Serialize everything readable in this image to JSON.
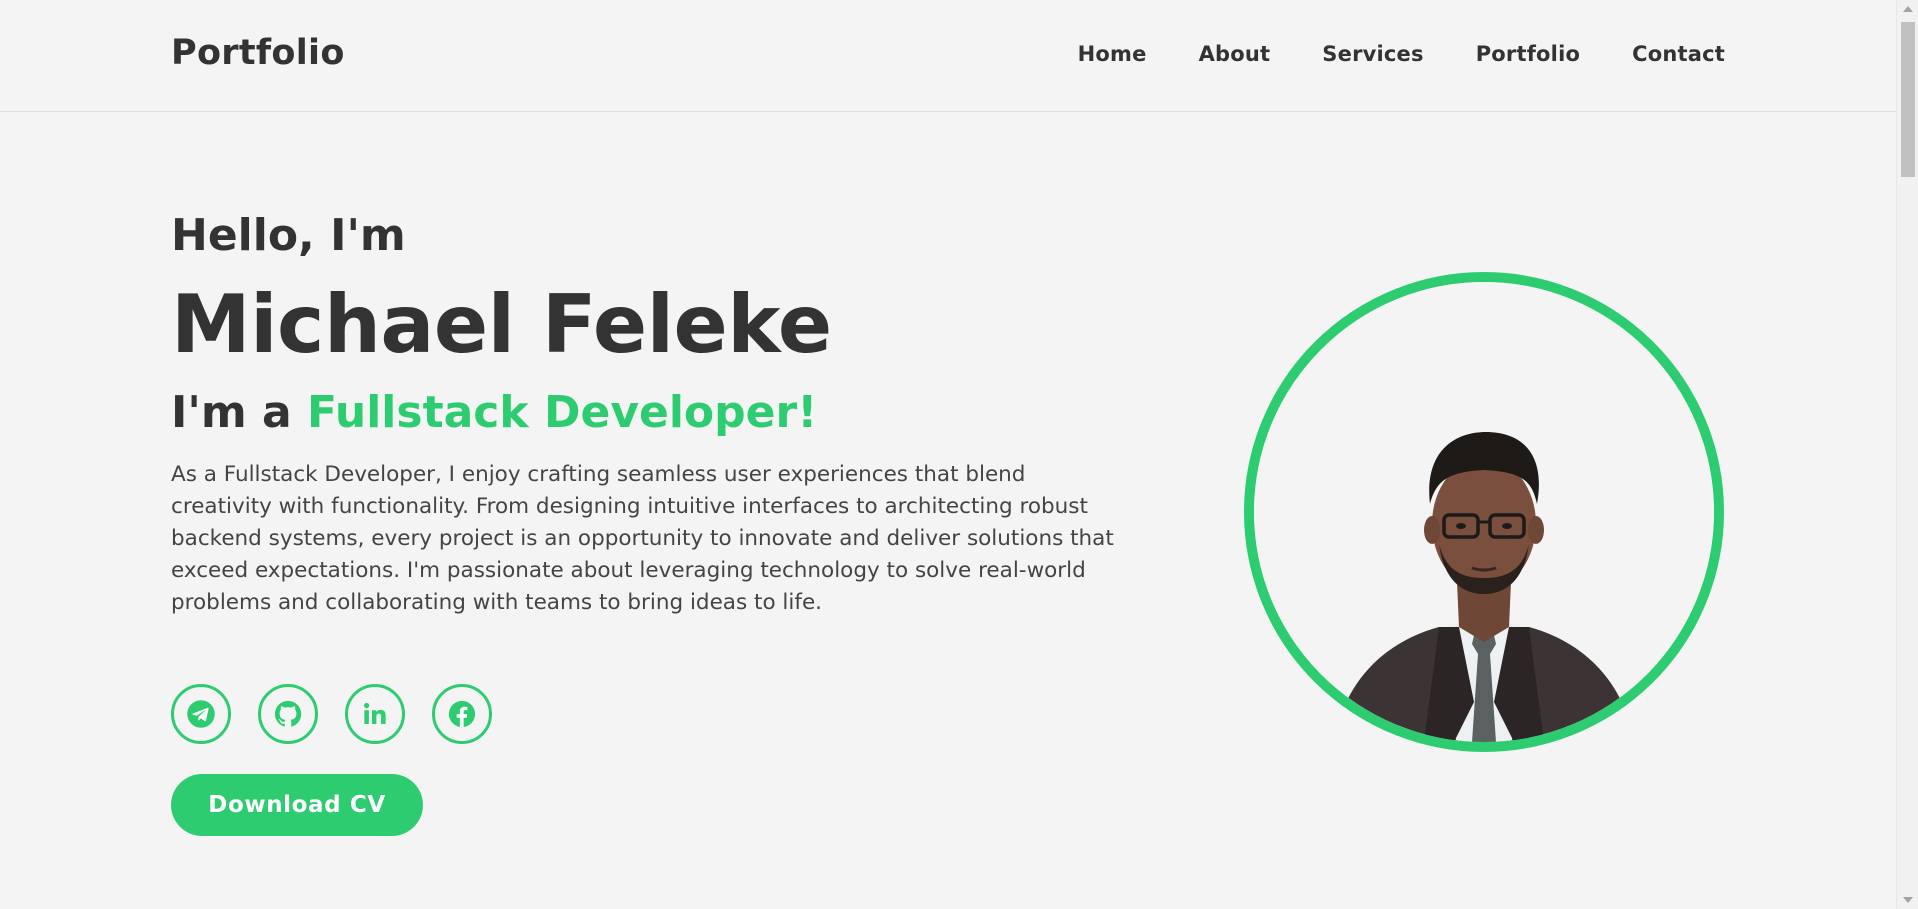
{
  "header": {
    "logo": "Portfolio",
    "nav": [
      "Home",
      "About",
      "Services",
      "Portfolio",
      "Contact"
    ]
  },
  "hero": {
    "greeting": "Hello, I'm",
    "name": "Michael Feleke",
    "role_prefix": "I'm a ",
    "role_accent": "Fullstack Developer!",
    "bio": "As a Fullstack Developer, I enjoy crafting seamless user experiences that blend creativity with functionality. From designing intuitive interfaces to architecting robust backend systems, every project is an opportunity to innovate and deliver solutions that exceed expectations. I'm passionate about leveraging technology to solve real-world problems and collaborating with teams to bring ideas to life.",
    "cv_button": "Download CV"
  },
  "socials": [
    {
      "icon": "telegram-icon"
    },
    {
      "icon": "github-icon"
    },
    {
      "icon": "linkedin-icon"
    },
    {
      "icon": "facebook-icon"
    }
  ],
  "colors": {
    "accent": "#2ecc71",
    "text": "#333333",
    "background": "#f4f4f4"
  }
}
